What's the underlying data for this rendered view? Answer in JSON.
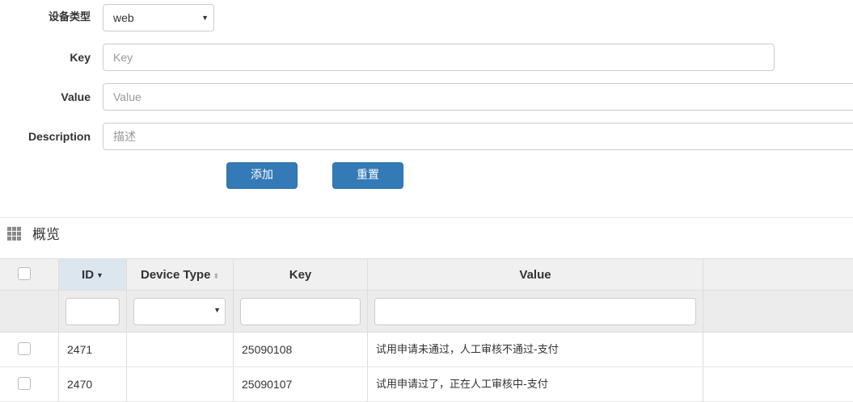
{
  "form": {
    "device_type": {
      "label": "设备类型",
      "value": "web"
    },
    "key": {
      "label": "Key",
      "placeholder": "Key"
    },
    "value": {
      "label": "Value",
      "placeholder": "Value"
    },
    "description": {
      "label": "Description",
      "placeholder": "描述"
    },
    "add_button": "添加",
    "reset_button": "重置"
  },
  "panel": {
    "title": "概览"
  },
  "table": {
    "columns": [
      "ID",
      "Device Type",
      "Key",
      "Value"
    ],
    "sorted_column": "ID",
    "rows": [
      {
        "id": "2471",
        "device_type": "",
        "key": "25090108",
        "value": "试用申请未通过，人工审核不通过-支付"
      },
      {
        "id": "2470",
        "device_type": "",
        "key": "25090107",
        "value": "试用申请过了，正在人工审核中-支付"
      }
    ]
  },
  "colors": {
    "primary": "#337ab7",
    "sorted_header": "#dbe6ee"
  }
}
